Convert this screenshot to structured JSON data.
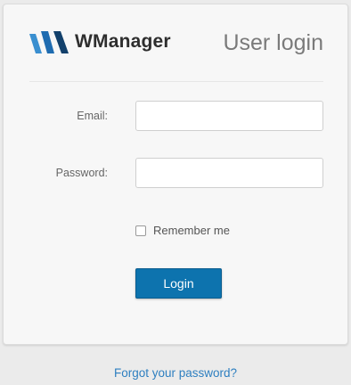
{
  "brand": {
    "name": "WManager",
    "logo_icon": "wmanager-logo-icon",
    "logo_colors": [
      "#3a8fd0",
      "#1f6cb0",
      "#12406b"
    ]
  },
  "header": {
    "title": "User login"
  },
  "form": {
    "email_label": "Email:",
    "email_value": "",
    "password_label": "Password:",
    "password_value": "",
    "remember_label": "Remember me",
    "remember_checked": false,
    "login_label": "Login"
  },
  "footer": {
    "forgot_password_label": "Forgot your password?"
  },
  "colors": {
    "accent": "#0d73ae",
    "link": "#2e7fc0"
  }
}
